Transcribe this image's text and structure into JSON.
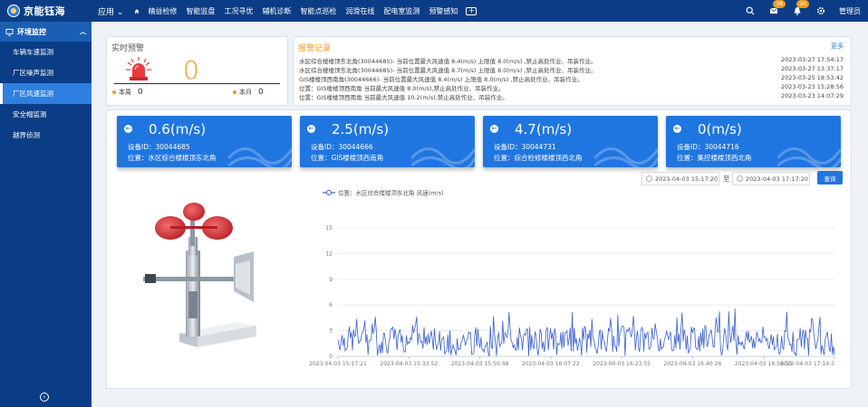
{
  "brand": {
    "name": "京能钰海"
  },
  "nav": {
    "apps_label": "应用",
    "items": [
      "精益检修",
      "智能监盘",
      "工况寻优",
      "辅机诊断",
      "智能点巡检",
      "润滑在线",
      "配电室监测",
      "预警感知"
    ]
  },
  "top_right": {
    "badge_1": "38",
    "badge_2": "20",
    "user": "管理员"
  },
  "sidebar": {
    "group": "环境监控",
    "items": [
      {
        "label": "车辆车速监测",
        "active": false
      },
      {
        "label": "厂区噪声监测",
        "active": false
      },
      {
        "label": "厂区风速监测",
        "active": true
      },
      {
        "label": "安全帽监测",
        "active": false
      },
      {
        "label": "越界侦测",
        "active": false
      }
    ]
  },
  "alarm": {
    "title": "实时预警",
    "count": "0",
    "week_label": "本周",
    "week_value": "0",
    "month_label": "本月",
    "month_value": "0"
  },
  "records": {
    "title": "报警记录",
    "more": "更多",
    "rows": [
      {
        "text": "水区综合楼楼顶东北角(30044685)- 当前位置最大风速值 8.4(m/s) 上限值 8.0(m/s) ,禁止高处作业、吊装作业。",
        "time": "2023-03-27 17:54:17"
      },
      {
        "text": "水区综合楼楼顶东北角(30044685)- 当前位置最大风速值 8.7(m/s) 上限值 8.0(m/s) ,禁止高处作业、吊装作业。",
        "time": "2023-03-27 13:37:17"
      },
      {
        "text": "GIS楼楼顶西南角(30044666)- 当前位置最大风速值 8.4(m/s) 上限值 8.0(m/s) ,禁止高处作业、吊装作业。",
        "time": "2023-03-25 18:53:42"
      },
      {
        "text": "位置：GIS楼楼顶西南角 当前最大风速值 8.0(m/s),禁止高处作业、吊装作业。",
        "time": "2023-03-23 15:28:56"
      },
      {
        "text": "位置：GIS楼楼顶西南角 当前最大风速值 10.2(m/s),禁止高处作业、吊装作业。",
        "time": "2023-03-23 14:07:29"
      }
    ]
  },
  "cards": [
    {
      "speed": "0.6(m/s)",
      "device": "设备ID：30044685",
      "location": "位置：水区综合楼楼顶东北角"
    },
    {
      "speed": "2.5(m/s)",
      "device": "设备ID：30044666",
      "location": "位置：GIS楼楼顶西南角"
    },
    {
      "speed": "4.7(m/s)",
      "device": "设备ID：30044731",
      "location": "位置：综合检修楼楼顶西北角"
    },
    {
      "speed": "0(m/s)",
      "device": "设备ID：30044716",
      "location": "位置：集控楼楼顶西北角"
    }
  ],
  "filter": {
    "start": "2023-04-03 15:17:20",
    "sep": "至",
    "end": "2023-04-03 17:17:20",
    "query": "查询"
  },
  "chart_data": {
    "type": "line",
    "legend": "位置：水区综合楼楼顶东北角 风速(m/s)",
    "ylim": [
      0,
      15
    ],
    "yticks": [
      0,
      3,
      6,
      9,
      12,
      15
    ],
    "xticks": [
      "2023-04-03 15:17:21",
      "2023-04-03 15:33:52",
      "2023-04-03 15:50:48",
      "2023-04-03 16:07:22",
      "2023-04-03 16:23:55",
      "2023-04-03 16:40:26",
      "2023-04-03 16:56:55",
      "2023-04-03 17:14:3"
    ],
    "grid": true,
    "legend_position": "top-left",
    "samples": 480,
    "min": 0,
    "max": 5.6,
    "typical_range": [
      0.5,
      3.5
    ],
    "series_color": "#3a5fcd",
    "series": [
      {
        "name": "位置：水区综合楼楼顶东北角 风速(m/s)"
      }
    ]
  }
}
